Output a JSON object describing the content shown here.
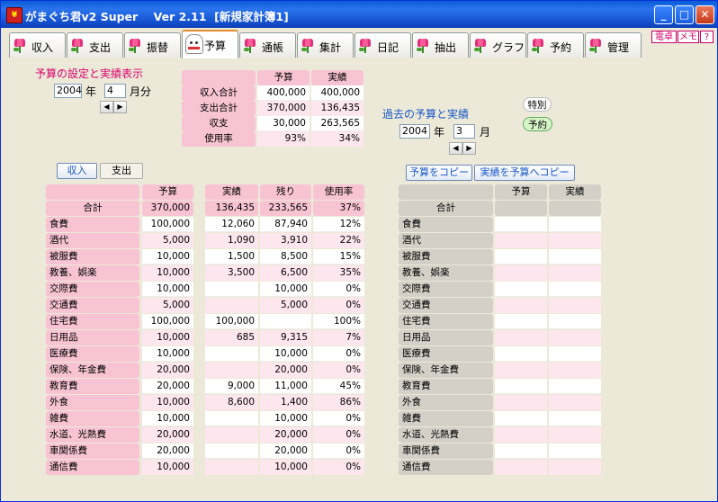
{
  "window": {
    "title": "がまぐち君v2 Super    Ver 2.11  [新規家計簿1]",
    "app_icon": "wallet-icon"
  },
  "tabs": [
    {
      "label": "収入",
      "icon": "tulip-icon"
    },
    {
      "label": "支出",
      "icon": "tulip-icon"
    },
    {
      "label": "振替",
      "icon": "tulip-icon"
    },
    {
      "label": "予算",
      "icon": "maneki-neko-icon",
      "active": true
    },
    {
      "label": "通帳",
      "icon": "tulip-icon"
    },
    {
      "label": "集計",
      "icon": "tulip-icon"
    },
    {
      "label": "日記",
      "icon": "tulip-icon"
    },
    {
      "label": "抽出",
      "icon": "tulip-icon"
    },
    {
      "label": "グラフ",
      "icon": "tulip-icon"
    },
    {
      "label": "予約",
      "icon": "tulip-icon"
    },
    {
      "label": "管理",
      "icon": "tulip-icon"
    }
  ],
  "corner_buttons": {
    "calc": "電卓",
    "memo": "メモ",
    "help": "?"
  },
  "budget_setting": {
    "title": "予算の設定と実績表示",
    "year": "2004",
    "year_unit": "年",
    "month": "4",
    "month_unit": "月分"
  },
  "summary": {
    "headers": [
      "予算",
      "実績"
    ],
    "rows": [
      {
        "label": "収入合計",
        "budget": "400,000",
        "actual": "400,000"
      },
      {
        "label": "支出合計",
        "budget": "370,000",
        "actual": "136,435"
      },
      {
        "label": "収支",
        "budget": "30,000",
        "actual": "263,565"
      },
      {
        "label": "使用率",
        "budget": "93%",
        "actual": "34%"
      }
    ]
  },
  "past": {
    "title": "過去の予算と実績",
    "year": "2004",
    "year_unit": "年",
    "month": "3",
    "month_unit": "月",
    "chip_special": "特別",
    "chip_reserve": "予約"
  },
  "toggle": {
    "income": "収入",
    "expense": "支出"
  },
  "copy_buttons": {
    "copy_budget": "予算をコピー",
    "copy_actual": "実績を予算へコピー"
  },
  "main_table": {
    "headers": {
      "budget": "予算",
      "actual": "実績",
      "remain": "残り",
      "rate": "使用率"
    },
    "total": {
      "label": "合計",
      "budget": "370,000",
      "actual": "136,435",
      "remain": "233,565",
      "rate": "37%"
    },
    "rows": [
      {
        "label": "食費",
        "budget": "100,000",
        "actual": "12,060",
        "remain": "87,940",
        "rate": "12%"
      },
      {
        "label": "酒代",
        "budget": "5,000",
        "actual": "1,090",
        "remain": "3,910",
        "rate": "22%"
      },
      {
        "label": "被服費",
        "budget": "10,000",
        "actual": "1,500",
        "remain": "8,500",
        "rate": "15%"
      },
      {
        "label": "教養、娯楽",
        "budget": "10,000",
        "actual": "3,500",
        "remain": "6,500",
        "rate": "35%"
      },
      {
        "label": "交際費",
        "budget": "10,000",
        "actual": "",
        "remain": "10,000",
        "rate": "0%"
      },
      {
        "label": "交通費",
        "budget": "5,000",
        "actual": "",
        "remain": "5,000",
        "rate": "0%"
      },
      {
        "label": "住宅費",
        "budget": "100,000",
        "actual": "100,000",
        "remain": "",
        "rate": "100%"
      },
      {
        "label": "日用品",
        "budget": "10,000",
        "actual": "685",
        "remain": "9,315",
        "rate": "7%"
      },
      {
        "label": "医療費",
        "budget": "10,000",
        "actual": "",
        "remain": "10,000",
        "rate": "0%"
      },
      {
        "label": "保険、年金費",
        "budget": "20,000",
        "actual": "",
        "remain": "20,000",
        "rate": "0%"
      },
      {
        "label": "教育費",
        "budget": "20,000",
        "actual": "9,000",
        "remain": "11,000",
        "rate": "45%"
      },
      {
        "label": "外食",
        "budget": "10,000",
        "actual": "8,600",
        "remain": "1,400",
        "rate": "86%"
      },
      {
        "label": "雑費",
        "budget": "10,000",
        "actual": "",
        "remain": "10,000",
        "rate": "0%"
      },
      {
        "label": "水道、光熱費",
        "budget": "20,000",
        "actual": "",
        "remain": "20,000",
        "rate": "0%"
      },
      {
        "label": "車関係費",
        "budget": "20,000",
        "actual": "",
        "remain": "20,000",
        "rate": "0%"
      },
      {
        "label": "通信費",
        "budget": "10,000",
        "actual": "",
        "remain": "10,000",
        "rate": "0%"
      }
    ]
  },
  "past_table": {
    "headers": {
      "budget": "予算",
      "actual": "実績"
    },
    "total_label": "合計",
    "rows": [
      "食費",
      "酒代",
      "被服費",
      "教養、娯楽",
      "交際費",
      "交通費",
      "住宅費",
      "日用品",
      "医療費",
      "保険、年金費",
      "教育費",
      "外食",
      "雑費",
      "水道、光熱費",
      "車関係費",
      "通信費"
    ]
  },
  "colors": {
    "accent_pink": "#d8006a",
    "accent_blue": "#1a58c8",
    "row_pink": "#f8c4d4",
    "row_gray": "#d4d0c8"
  }
}
